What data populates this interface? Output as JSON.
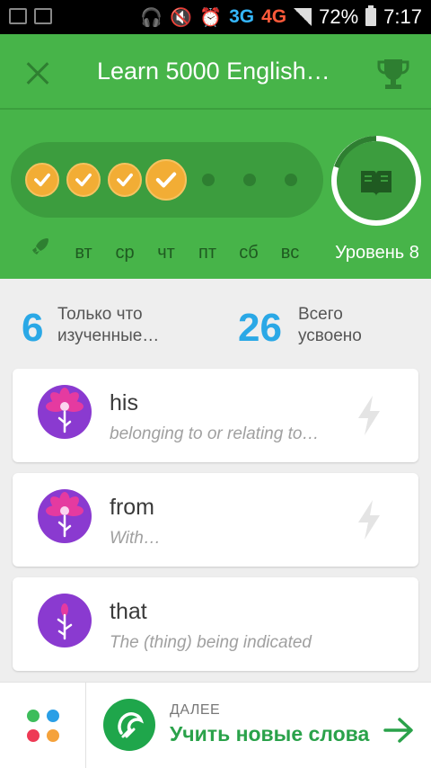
{
  "status_bar": {
    "network_3g": "3G",
    "network_4g": "4G",
    "battery": "72%",
    "time": "7:17"
  },
  "header": {
    "title": "Learn 5000 English…",
    "days": [
      "вт",
      "ср",
      "чт",
      "пт",
      "сб",
      "вс"
    ],
    "level": "Уровень 8",
    "completed_days": 4,
    "colors": {
      "header_bg": "#47b449",
      "pill_bg": "#3c9d3e",
      "check": "#f2ad35"
    }
  },
  "stats": {
    "recent": {
      "count": "6",
      "label_line1": "Только что",
      "label_line2": "изученные…"
    },
    "total": {
      "count": "26",
      "label_line1": "Всего",
      "label_line2": "усвоено"
    }
  },
  "words": [
    {
      "word": "his",
      "gloss": "belonging to or relating to…"
    },
    {
      "word": "from",
      "gloss": "With…"
    },
    {
      "word": "that",
      "gloss": "The (thing) being indicated"
    }
  ],
  "bottom": {
    "next_label": "ДАЛЕЕ",
    "next_title": "Учить новые слова"
  }
}
